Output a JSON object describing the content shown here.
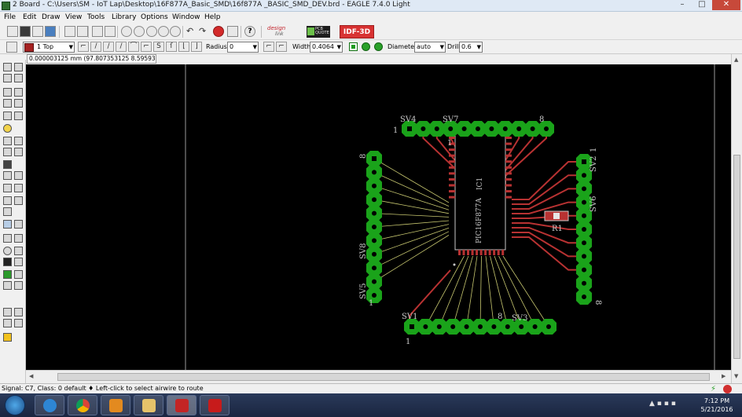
{
  "window": {
    "title": "2 Board - C:\\Users\\SM - IoT Lap\\Desktop\\16F877A_Basic_SMD\\16f877A _BASIC_SMD_DEV.brd - EAGLE 7.4.0 Light",
    "minimize": "–",
    "maximize": "□",
    "close": "✕"
  },
  "menu": [
    "File",
    "Edit",
    "Draw",
    "View",
    "Tools",
    "Library",
    "Options",
    "Window",
    "Help"
  ],
  "toolbar": {
    "designlink_top": "design",
    "designlink_bottom": "link",
    "pcbquote_top": "PCB",
    "pcbquote_bottom": "QUOTE",
    "idf_label": "IDF-3D",
    "help_icon": "?"
  },
  "params": {
    "layer": "1 Top",
    "radius_label": "Radius:",
    "radius": "0",
    "width_label": "Width:",
    "width": "0.4064",
    "diameter_label": "Diameter:",
    "diameter": "auto",
    "drill_label": "Drill:",
    "drill": "0.6"
  },
  "coordinate_readout": "0.000003125 mm (97.807353125 8.595931250)",
  "board": {
    "chip_name": "IC1",
    "chip_value": "PIC16F877A",
    "resistor": "R1",
    "headers": [
      {
        "name": "SV4",
        "pin_first": "1",
        "pin_last": ""
      },
      {
        "name": "SV7",
        "pin_first": "1",
        "pin_last": "8"
      },
      {
        "name": "SV2",
        "pin_first": "1",
        "pin_last": ""
      },
      {
        "name": "SV6",
        "pin_first": "",
        "pin_last": "8"
      },
      {
        "name": "SV8",
        "pin_first": "",
        "pin_last": "8"
      },
      {
        "name": "SV5",
        "pin_first": "1",
        "pin_last": ""
      },
      {
        "name": "SV1",
        "pin_first": "1",
        "pin_last": "8"
      },
      {
        "name": "SV3",
        "pin_first": "",
        "pin_last": ""
      }
    ]
  },
  "status": {
    "text": "Signal: C7, Class: 0 default  ♦ Left-click to select airwire to route"
  },
  "taskbar": {
    "clock_time": "7:12 PM",
    "clock_date": "5/21/2016"
  },
  "colors": {
    "pad": "#1aa31a",
    "trace": "#b83232",
    "airwire": "#c8c870",
    "silkscreen": "#c8c8c8"
  }
}
